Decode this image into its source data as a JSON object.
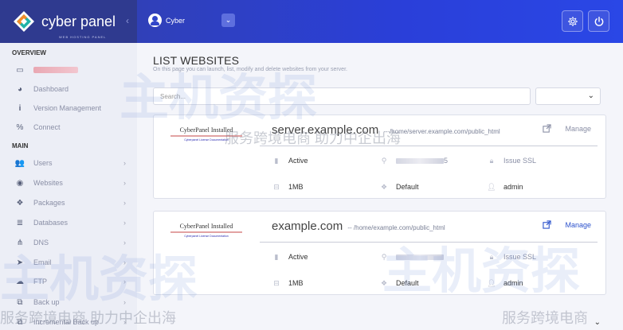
{
  "brand": {
    "name": "cyber panel",
    "tagline": "WEB HOSTING PANEL"
  },
  "topbar": {
    "user_name": "Cyber",
    "icons": [
      "gear-icon",
      "power-icon"
    ]
  },
  "sidebar": {
    "overview_heading": "OVERVIEW",
    "overview_items": [
      {
        "label": "Dashboard",
        "icon": "speedometer-icon"
      },
      {
        "label": "Version Management",
        "icon": "info-icon"
      },
      {
        "label": "Connect",
        "icon": "link-icon"
      }
    ],
    "main_heading": "MAIN",
    "main_items": [
      {
        "label": "Users",
        "icon": "users-icon"
      },
      {
        "label": "Websites",
        "icon": "globe-icon"
      },
      {
        "label": "Packages",
        "icon": "cubes-icon"
      },
      {
        "label": "Databases",
        "icon": "database-icon"
      },
      {
        "label": "DNS",
        "icon": "sitemap-icon"
      },
      {
        "label": "Email",
        "icon": "paper-plane-icon"
      },
      {
        "label": "FTP",
        "icon": "cloud-upload-icon"
      },
      {
        "label": "Back up",
        "icon": "copy-icon"
      },
      {
        "label": "Incremental Back up",
        "icon": "copy-icon"
      }
    ]
  },
  "page": {
    "title": "LIST WEBSITES",
    "description": "On this page you can launch, list, modify and delete websites from your server.",
    "search_placeholder": "Search..."
  },
  "websites": [
    {
      "thumb_title": "CyberPanel Installed",
      "thumb_link": "Cyberpanel License Documentation",
      "domain": "server.example.com",
      "path": "-- /home/server.example.com/public_html",
      "manage": "Manage",
      "status": "Active",
      "ip_suffix": "5",
      "ssl": "Issue SSL",
      "disk": "1MB",
      "package": "Default",
      "owner": "admin"
    },
    {
      "thumb_title": "CyberPanel Installed",
      "thumb_link": "Cyberpanel License Documentation",
      "domain": "example.com",
      "path": "-- /home/example.com/public_html",
      "manage": "Manage",
      "status": "Active",
      "ip_suffix": "",
      "ssl": "Issue SSL",
      "disk": "1MB",
      "package": "Default",
      "owner": "admin"
    }
  ],
  "watermarks": {
    "big": "主机资探",
    "cn_line": "服务跨境电商 助力中企出海",
    "cn_right": "服务跨境电商"
  }
}
